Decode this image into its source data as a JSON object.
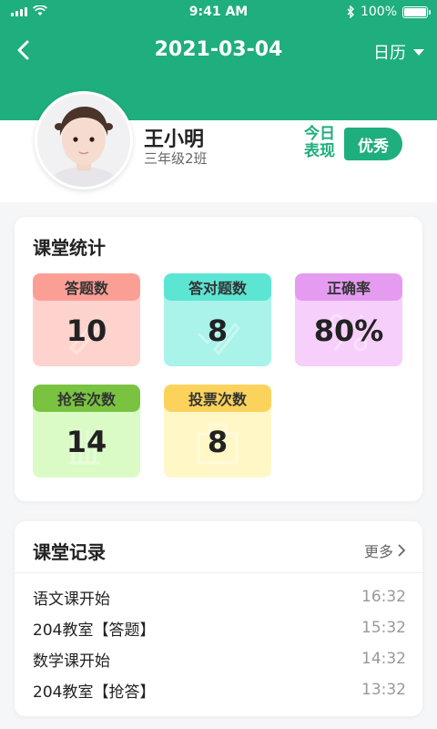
{
  "status_bar": {
    "time": "9:41 AM",
    "battery": "100%"
  },
  "nav": {
    "date": "2021-03-04",
    "calendar_label": "日历"
  },
  "student": {
    "name": "王小明",
    "class": "三年级2班",
    "perf_label_line1": "今日",
    "perf_label_line2": "表现",
    "perf_value": "优秀"
  },
  "stats": {
    "title": "课堂统计",
    "items": [
      {
        "label": "答题数",
        "value": "10"
      },
      {
        "label": "答对题数",
        "value": "8"
      },
      {
        "label": "正确率",
        "value": "80%"
      },
      {
        "label": "抢答次数",
        "value": "14"
      },
      {
        "label": "投票次数",
        "value": "8"
      }
    ]
  },
  "records": {
    "title": "课堂记录",
    "more": "更多",
    "items": [
      {
        "title": "语文课开始",
        "time": "16:32"
      },
      {
        "title": "204教室【答题】",
        "time": "15:32"
      },
      {
        "title": "数学课开始",
        "time": "14:32"
      },
      {
        "title": "204教室【抢答】",
        "time": "13:32"
      }
    ]
  },
  "colors": {
    "brand": "#1fae7d",
    "card1_head": "#fb9f95",
    "card1_body": "#ffd3cd",
    "card2_head": "#5de5d3",
    "card2_body": "#a9f3ea",
    "card3_head": "#e59bf0",
    "card3_body": "#f6cffb",
    "card4_head": "#79c341",
    "card4_body": "#dafbc6",
    "card5_head": "#fbd35c",
    "card5_body": "#fff8c6"
  }
}
